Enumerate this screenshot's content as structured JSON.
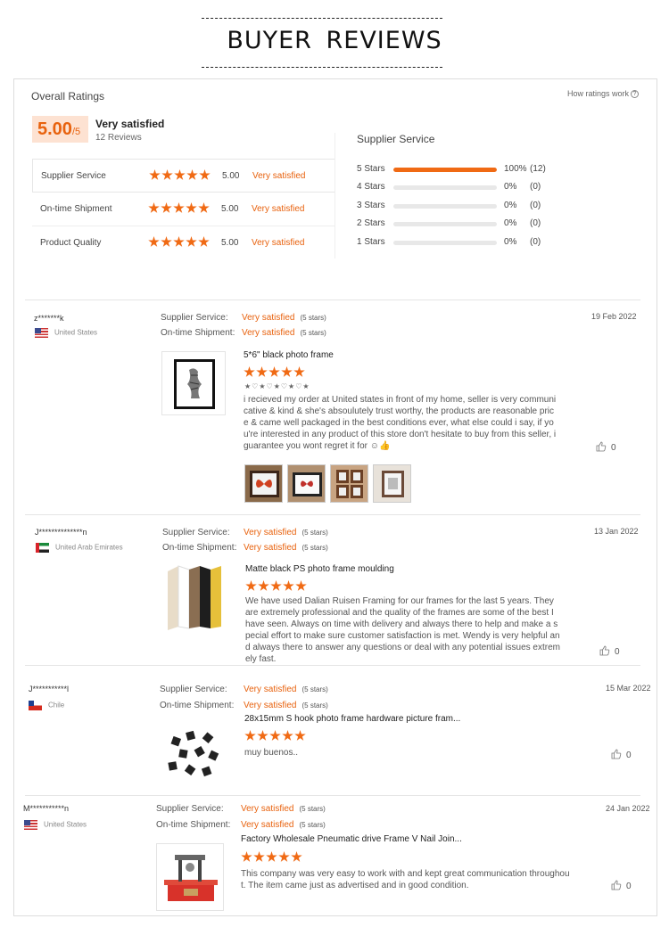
{
  "page": {
    "title": "BUYER  REVIEWS"
  },
  "overall": {
    "title": "Overall Ratings",
    "how_link": "How ratings work",
    "score": "5.00",
    "score_den": "/5",
    "satisfaction": "Very satisfied",
    "review_count": "12 Reviews",
    "ratings": [
      {
        "label": "Supplier Service",
        "value": "5.00",
        "satisfaction": "Very satisfied",
        "stars": 5
      },
      {
        "label": "On-time Shipment",
        "value": "5.00",
        "satisfaction": "Very satisfied",
        "stars": 5
      },
      {
        "label": "Product Quality",
        "value": "5.00",
        "satisfaction": "Very satisfied",
        "stars": 5
      }
    ]
  },
  "supplier_service": {
    "title": "Supplier Service",
    "distribution": [
      {
        "label": "5 Stars",
        "fraction": 1.0,
        "percent": "100%",
        "count": "(12)"
      },
      {
        "label": "4 Stars",
        "fraction": 0,
        "percent": "0%",
        "count": "(0)"
      },
      {
        "label": "3 Stars",
        "fraction": 0,
        "percent": "0%",
        "count": "(0)"
      },
      {
        "label": "2 Stars",
        "fraction": 0,
        "percent": "0%",
        "count": "(0)"
      },
      {
        "label": "1 Stars",
        "fraction": 0,
        "percent": "0%",
        "count": "(0)"
      }
    ]
  },
  "labels": {
    "supplier_service": "Supplier Service:",
    "ontime_shipment": "On-time Shipment:"
  },
  "reviews": [
    {
      "user": "z*******k",
      "country": "United States",
      "flag": "us-flag-icon",
      "supplier_service": "Very satisfied",
      "supplier_stars": "(5 stars)",
      "ontime_shipment": "Very satisfied",
      "ontime_stars": "(5 stars)",
      "date": "19 Feb 2022",
      "product": "5*6\" black photo frame",
      "rating": 5,
      "hearts": "★♡★♡★♡★♡★",
      "text": "i recieved my order at United states in front of my home, seller is very communicative & kind & she's absoulutely trust worthy, the products are reasonable price & came well packaged in the best conditions ever, what else could i say, if you're interested in any product of this store don't hesitate to buy from this seller, i guarantee you wont regret it for ☺👍",
      "likes": "0"
    },
    {
      "user": "J**************n",
      "country": "United Arab Emirates",
      "flag": "uae-flag-icon",
      "supplier_service": "Very satisfied",
      "supplier_stars": "(5 stars)",
      "ontime_shipment": "Very satisfied",
      "ontime_stars": "(5 stars)",
      "date": "13 Jan 2022",
      "product": "Matte black PS photo frame moulding",
      "rating": 5,
      "text": "We have used Dalian Ruisen Framing for our frames for the last 5 years. They are extremely professional and the quality of the frames are some of the best I have seen. Always on time with delivery and always there to help and make a special effort to make sure customer satisfaction is met. Wendy is very helpful and always there to answer any questions or deal with any potential issues extremely fast.",
      "likes": "0"
    },
    {
      "user": "J***********l",
      "country": "Chile",
      "flag": "chile-flag-icon",
      "supplier_service": "Very satisfied",
      "supplier_stars": "(5 stars)",
      "ontime_shipment": "Very satisfied",
      "ontime_stars": "(5 stars)",
      "date": "15 Mar 2022",
      "product": "28x15mm S hook photo frame hardware picture fram...",
      "rating": 5,
      "text": "muy buenos..",
      "likes": "0"
    },
    {
      "user": "M***********n",
      "country": "United States",
      "flag": "us-flag-icon",
      "supplier_service": "Very satisfied",
      "supplier_stars": "(5 stars)",
      "ontime_shipment": "Very satisfied",
      "ontime_stars": "(5 stars)",
      "date": "24 Jan 2022",
      "product": "Factory Wholesale Pneumatic drive Frame V Nail Join...",
      "rating": 5,
      "text": "This company was very easy to work with and kept great communication throughout. The item came just as advertised and in good condition.",
      "likes": "0"
    }
  ]
}
